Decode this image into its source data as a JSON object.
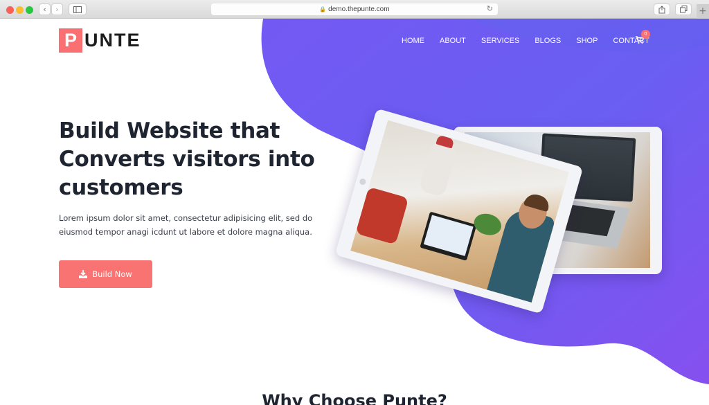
{
  "browser": {
    "url": "demo.thepunte.com",
    "back_icon": "‹",
    "forward_icon": "›",
    "new_tab_icon": "+"
  },
  "site": {
    "logo_letter": "P",
    "logo_rest": "UNTE",
    "brand_color": "#fa6f72",
    "accent_color": "#6d5cf0"
  },
  "nav": {
    "items": [
      {
        "label": "HOME"
      },
      {
        "label": "ABOUT"
      },
      {
        "label": "SERVICES"
      },
      {
        "label": "BLOGS"
      },
      {
        "label": "SHOP"
      },
      {
        "label": "CONTACT"
      }
    ],
    "cart_count": "0"
  },
  "hero": {
    "headline_lines": [
      "Build Website that",
      "Converts visitors into",
      "customers"
    ],
    "lead": "Lorem ipsum dolor sit amet, consectetur adipisicing elit, sed do eiusmod tempor anagi icdunt ut labore et dolore magna aliqua.",
    "cta_label": "Build Now"
  },
  "section": {
    "title": "Why Choose Punte?"
  }
}
